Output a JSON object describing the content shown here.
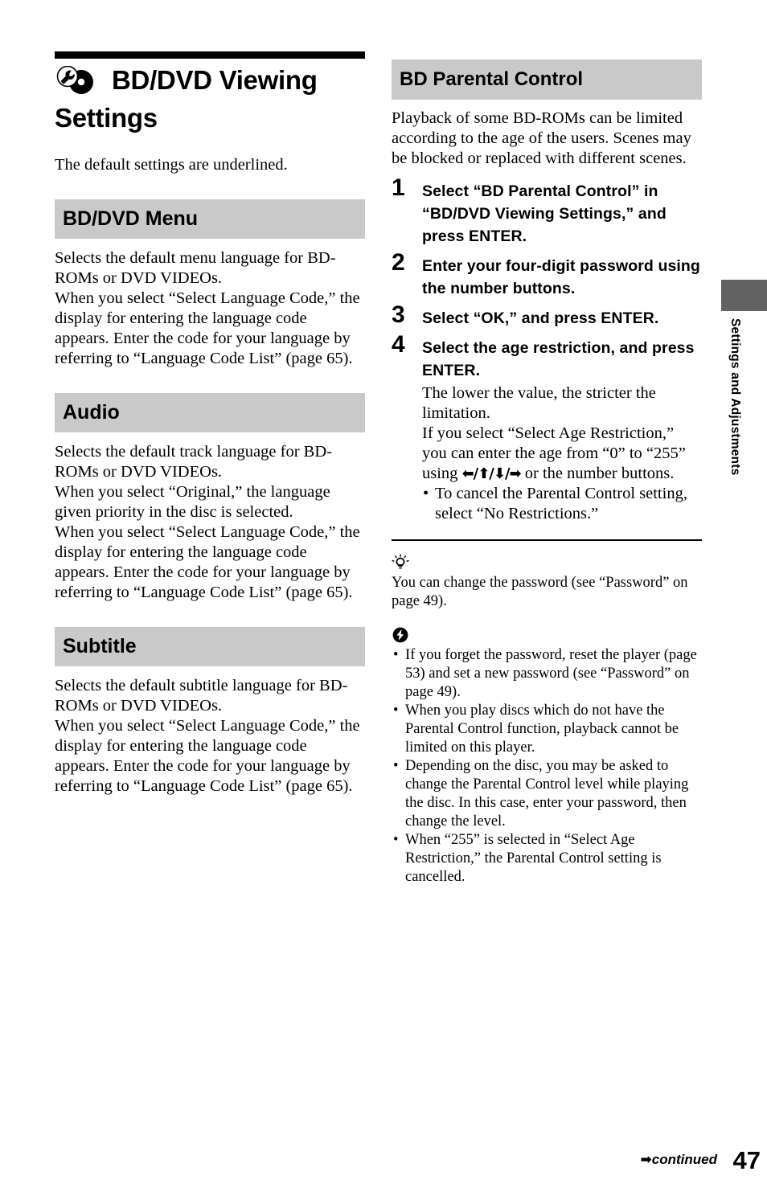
{
  "page": {
    "number": "47",
    "continued_label": "continued",
    "continued_arrow": "➡",
    "side_tab_label": "Settings and Adjustments",
    "side_tab_color": "#636363",
    "section_head_bg": "#c9c9c9"
  },
  "chapter": {
    "icon": "wrench-disc-icon",
    "title": "BD/DVD Viewing Settings",
    "intro": "The default settings are underlined."
  },
  "left_sections": [
    {
      "heading": "BD/DVD Menu",
      "paragraphs": [
        "Selects the default menu language for BD-ROMs or DVD VIDEOs.",
        "When you select “Select Language Code,” the display for entering the language code appears. Enter the code for your language by referring to “Language Code List” (page 65)."
      ]
    },
    {
      "heading": "Audio",
      "paragraphs": [
        "Selects the default track language for BD-ROMs or DVD VIDEOs.",
        "When you select “Original,” the language given priority in the disc is selected.",
        "When you select “Select Language Code,” the display for entering the language code appears. Enter the code for your language by referring to “Language Code List” (page 65)."
      ]
    },
    {
      "heading": "Subtitle",
      "paragraphs": [
        "Selects the default subtitle language for BD-ROMs or DVD VIDEOs.",
        "When you select “Select Language Code,” the display for entering the language code appears. Enter the code for your language by referring to “Language Code List” (page 65)."
      ]
    }
  ],
  "right_section": {
    "heading": "BD Parental Control",
    "intro": "Playback of some BD-ROMs can be limited according to the age of the users. Scenes may be blocked or replaced with different scenes.",
    "steps": [
      {
        "num": "1",
        "text": "Select “BD Parental Control” in “BD/DVD Viewing Settings,” and press ENTER."
      },
      {
        "num": "2",
        "text": "Enter your four-digit password using the number buttons."
      },
      {
        "num": "3",
        "text": "Select “OK,” and press ENTER."
      },
      {
        "num": "4",
        "text": "Select the age restriction, and press ENTER.",
        "sub_lines": [
          "The lower the value, the stricter the limitation.",
          "If you select “Select Age Restriction,” you can enter the age from “0” to “255” using "
        ],
        "sub_arrows": "⬅/⬆/⬇/➡",
        "sub_tail": " or the number buttons.",
        "bullets": [
          "To cancel the Parental Control setting, select “No Restrictions.”"
        ]
      }
    ],
    "tip": {
      "icon": "lightbulb-tip-icon",
      "text": "You can change the password (see “Password” on page 49)."
    },
    "note": {
      "icon": "lightning-note-icon",
      "items": [
        "If you forget the password, reset the player (page 53) and set a new password (see “Password” on page 49).",
        "When you play discs which do not have the Parental Control function, playback cannot be limited on this player.",
        "Depending on the disc, you may be asked to change the Parental Control level while playing the disc. In this case, enter your password, then change the level.",
        "When “255” is selected in “Select Age Restriction,” the Parental Control setting is cancelled."
      ]
    }
  }
}
